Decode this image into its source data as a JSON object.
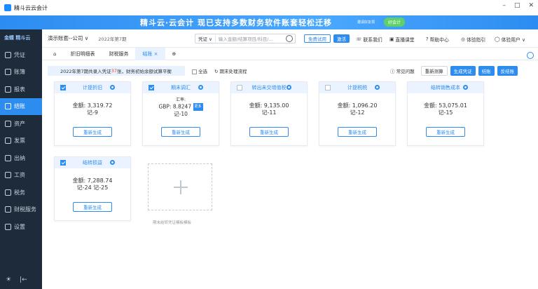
{
  "window": {
    "title": "精斗云云会计",
    "controls": [
      "–",
      "□",
      "✕"
    ]
  },
  "banner": {
    "text": "精斗云·云会计  现已支持多数财务软件账套轻松迁移",
    "gift": "好会计",
    "gift_small": "邀请好友领"
  },
  "sidebar": {
    "logo": "金蝶 精斗云",
    "items": [
      {
        "label": "凭证"
      },
      {
        "label": "账簿"
      },
      {
        "label": "报表"
      },
      {
        "label": "结账"
      },
      {
        "label": "资产"
      },
      {
        "label": "发票"
      },
      {
        "label": "出纳"
      },
      {
        "label": "工资"
      },
      {
        "label": "税务"
      },
      {
        "label": "财税服务"
      },
      {
        "label": "设置"
      }
    ],
    "bottom": [
      "☀",
      "|←"
    ]
  },
  "toolbar": {
    "company": "演示账套--公司 ∨",
    "period": "2022年第7期",
    "search_type": "凭证 ∨",
    "search_placeholder": "输入金额/结算项目/科目/...",
    "trial": "免费试用",
    "activate": "激活",
    "links": [
      "联系我们",
      "直播课堂",
      "帮助中心",
      "体验指引",
      "体验用户 ∨"
    ]
  },
  "tabs": [
    "折旧明细表",
    "财税服务",
    "结账 ×"
  ],
  "notice": {
    "pre": "2022年第7期共录入凭证",
    "count": "37",
    "post": "张，财务初始余额试算平衡"
  },
  "options": {
    "select_all": "全选",
    "flow": "期末处理流程"
  },
  "actions": {
    "faq": "常见问题",
    "recalc": "重新测算",
    "generate": "生成凭证",
    "close": "结账",
    "unclose": "反结账"
  },
  "cards": [
    {
      "title": "计提折旧",
      "checked": true,
      "line1": "金额:  3,319.72",
      "line2": "记-9",
      "button": "重新生成"
    },
    {
      "title": "期末调汇",
      "checked": true,
      "line0": "汇率:",
      "line1": "GBP: 8.8247",
      "line2": "记-10",
      "more": "更多",
      "button": "重新生成"
    },
    {
      "title": "转出未交增值税",
      "checked": false,
      "line1": "金额:  9,135.00",
      "line2": "记-11",
      "button": "重新生成"
    },
    {
      "title": "计提税税",
      "checked": false,
      "line1": "金额:  1,096.20",
      "line2": "记-12",
      "button": "重新生成"
    },
    {
      "title": "结转销售成本",
      "checked": false,
      "line1": "金额:  53,075.01",
      "line2": "记-15",
      "button": "重新生成"
    },
    {
      "title": "结转损益",
      "checked": true,
      "line1": "金额:  7,288.74",
      "line2": "记-24 记-25",
      "button": "重新生成"
    }
  ],
  "add_card_label": "期末结转凭证模板模板"
}
